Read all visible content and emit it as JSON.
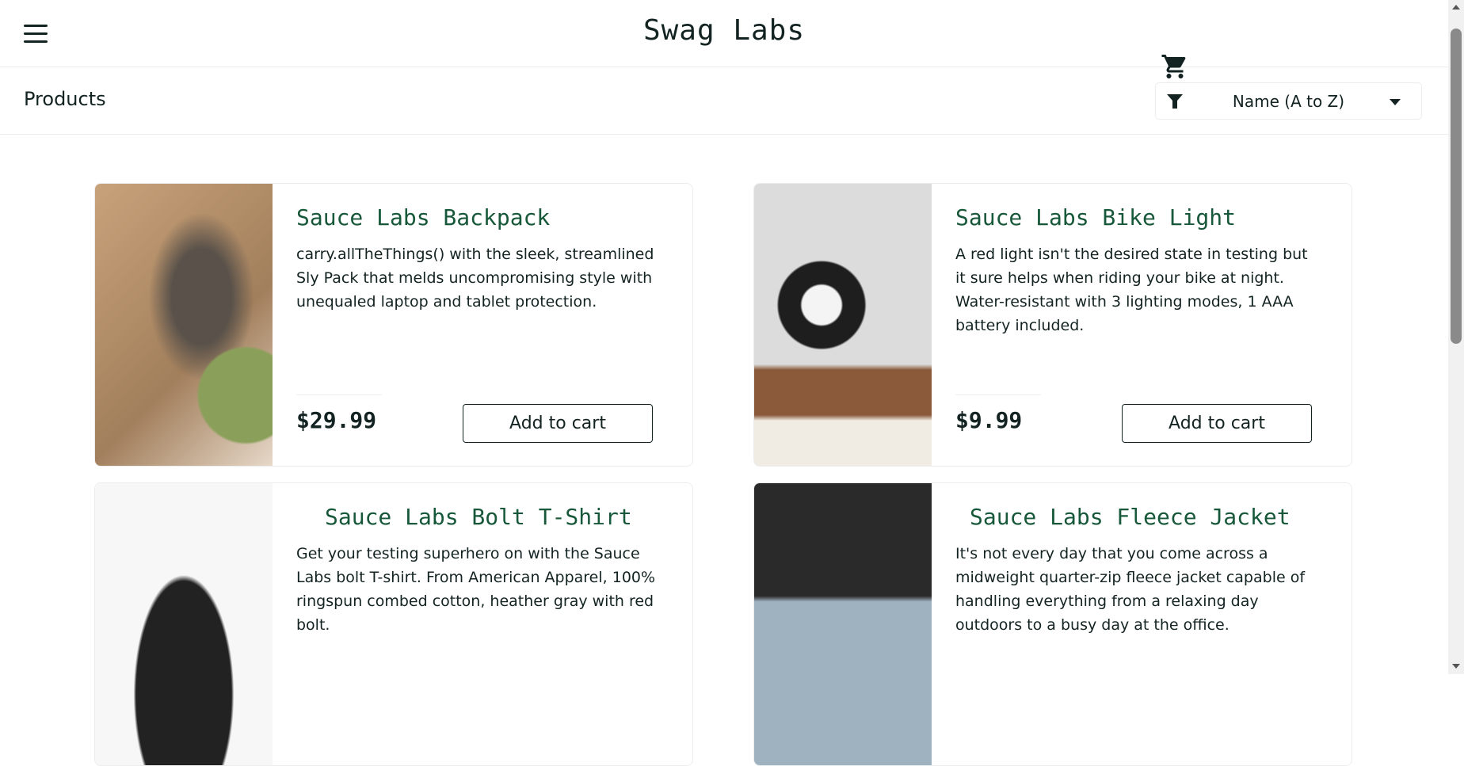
{
  "header": {
    "title": "Swag Labs"
  },
  "subheader": {
    "title": "Products",
    "sort": {
      "selected": "Name (A to Z)"
    }
  },
  "products": [
    {
      "name": "Sauce Labs Backpack",
      "description": "carry.allTheThings() with the sleek, streamlined Sly Pack that melds uncompromising style with unequaled laptop and tablet protection.",
      "price": "$29.99",
      "button": "Add to cart"
    },
    {
      "name": "Sauce Labs Bike Light",
      "description": "A red light isn't the desired state in testing but it sure helps when riding your bike at night. Water-resistant with 3 lighting modes, 1 AAA battery included.",
      "price": "$9.99",
      "button": "Add to cart"
    },
    {
      "name": "Sauce Labs Bolt T-Shirt",
      "description": "Get your testing superhero on with the Sauce Labs bolt T-shirt. From American Apparel, 100% ringspun combed cotton, heather gray with red bolt."
    },
    {
      "name": "Sauce Labs Fleece Jacket",
      "description": "It's not every day that you come across a midweight quarter-zip fleece jacket capable of handling everything from a relaxing day outdoors to a busy day at the office."
    }
  ]
}
